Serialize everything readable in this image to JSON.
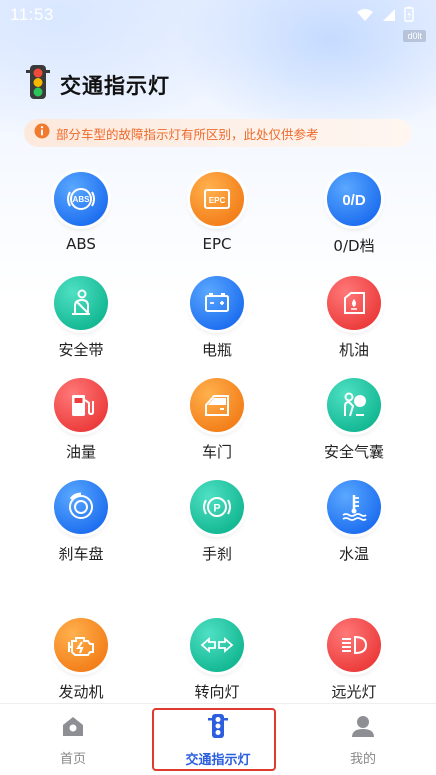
{
  "status_bar": {
    "time": "11:53",
    "tag": "d0lt"
  },
  "header": {
    "title": "交通指示灯"
  },
  "notice": {
    "text": "部分车型的故障指示灯有所区别，此处仅供参考"
  },
  "indicators": [
    {
      "label": "ABS",
      "icon": "abs-icon",
      "color": "#1e6ff0",
      "icon_text": "ABS"
    },
    {
      "label": "EPC",
      "icon": "epc-icon",
      "color": "#f37f1a",
      "icon_text": "EPC"
    },
    {
      "label": "0/D档",
      "icon": "od-icon",
      "color": "#1e6ff0",
      "icon_text": "0/D"
    },
    {
      "label": "安全带",
      "icon": "seatbelt-icon",
      "color": "#14b893"
    },
    {
      "label": "电瓶",
      "icon": "battery-icon",
      "color": "#1e6ff0"
    },
    {
      "label": "机油",
      "icon": "oil-icon",
      "color": "#ec3c3c"
    },
    {
      "label": "油量",
      "icon": "fuel-icon",
      "color": "#ec3c3c"
    },
    {
      "label": "车门",
      "icon": "door-icon",
      "color": "#f37f1a"
    },
    {
      "label": "安全气囊",
      "icon": "airbag-icon",
      "color": "#14b893"
    },
    {
      "label": "刹车盘",
      "icon": "brake-disc-icon",
      "color": "#1e6ff0"
    },
    {
      "label": "手刹",
      "icon": "parking-brake-icon",
      "color": "#14b893",
      "icon_text": "P"
    },
    {
      "label": "水温",
      "icon": "water-temp-icon",
      "color": "#1e6ff0"
    },
    {
      "label": "发动机",
      "icon": "engine-icon",
      "color": "#f37f1a"
    },
    {
      "label": "转向灯",
      "icon": "turn-signal-icon",
      "color": "#14b893"
    },
    {
      "label": "远光灯",
      "icon": "high-beam-icon",
      "color": "#ec3c3c",
      "icon_text": "≡D"
    }
  ],
  "tabbar": {
    "items": [
      {
        "label": "首页",
        "icon": "home-icon",
        "active": false
      },
      {
        "label": "交通指示灯",
        "icon": "traffic-light-icon",
        "active": true
      },
      {
        "label": "我的",
        "icon": "profile-icon",
        "active": false
      }
    ],
    "active_color": "#2b5fe0",
    "highlight_color": "#e03a2e"
  }
}
